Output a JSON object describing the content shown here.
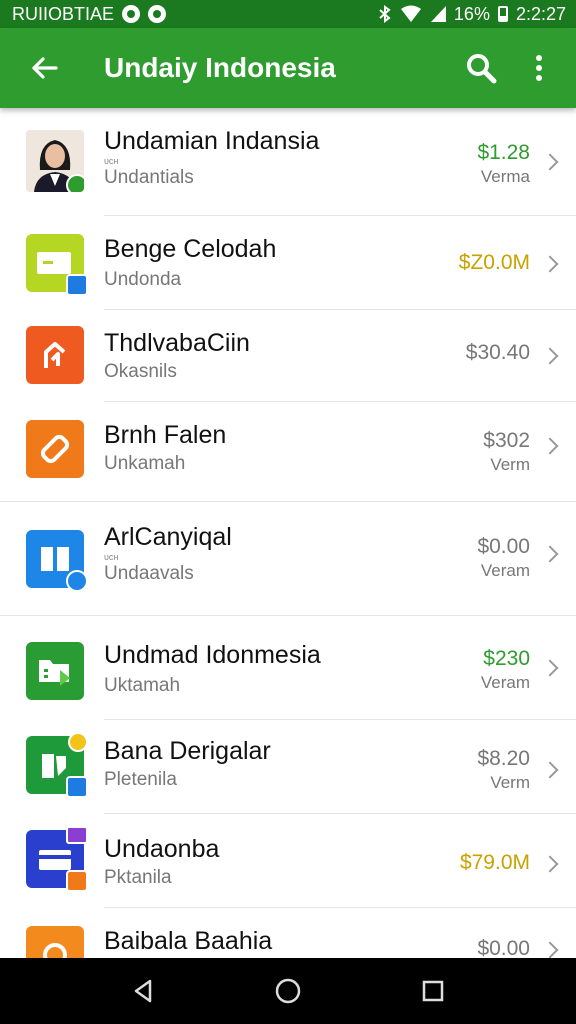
{
  "status_bar": {
    "left_text": "RUIIOBTIAE",
    "battery": "16%",
    "time": "2:2:27"
  },
  "app_bar": {
    "title": "Undaiy Indonesia"
  },
  "colors": {
    "primary": "#2e9c2f",
    "status": "#1b7a1f",
    "price_green": "#2e9c2f",
    "price_gold": "#c9a200",
    "price_gray": "#777777"
  },
  "items": [
    {
      "title": "Undamian Indansia",
      "tiny": "ᴜᴄʜ",
      "subtitle": "Undantials",
      "price": "$1.28",
      "period": "Verma",
      "icon": "avatar-image",
      "price_color": "green"
    },
    {
      "title": "Benge Celodah",
      "tiny": "",
      "subtitle": "Undonda",
      "price": "$Z0.0M",
      "period": "",
      "icon": "wallet-icon",
      "price_color": "gold"
    },
    {
      "title": "ThdlvabaCiin",
      "tiny": "",
      "subtitle": "Okasnils",
      "price": "$30.40",
      "period": "",
      "icon": "share-house-icon",
      "price_color": "gray"
    },
    {
      "title": "Brnh Falen",
      "tiny": "",
      "subtitle": "Unkamah",
      "price": "$302",
      "period": "Verm",
      "icon": "tag-icon",
      "price_color": "gray"
    },
    {
      "title": "ArlCanyiqal",
      "tiny": "ᴜᴄʜ",
      "subtitle": "Undaavals",
      "price": "$0.00",
      "period": "Veram",
      "icon": "book-icon",
      "price_color": "gray"
    },
    {
      "title": "Undmad Idonmesia",
      "tiny": "",
      "subtitle": "Uktamah",
      "price": "$230",
      "period": "Veram",
      "icon": "folder-icon",
      "price_color": "green"
    },
    {
      "title": "Bana Derigalar",
      "tiny": "",
      "subtitle": "Pletenila",
      "price": "$8.20",
      "period": "Verm",
      "icon": "document-icon",
      "price_color": "gray"
    },
    {
      "title": "Undaonba",
      "tiny": "",
      "subtitle": "Pktanila",
      "price": "$79.0M",
      "period": "",
      "icon": "card-icon",
      "price_color": "gold"
    },
    {
      "title": "Baibala Baahia",
      "tiny": "",
      "subtitle": "",
      "price": "$0.00",
      "period": "",
      "icon": "chat-icon",
      "price_color": "gray"
    }
  ]
}
